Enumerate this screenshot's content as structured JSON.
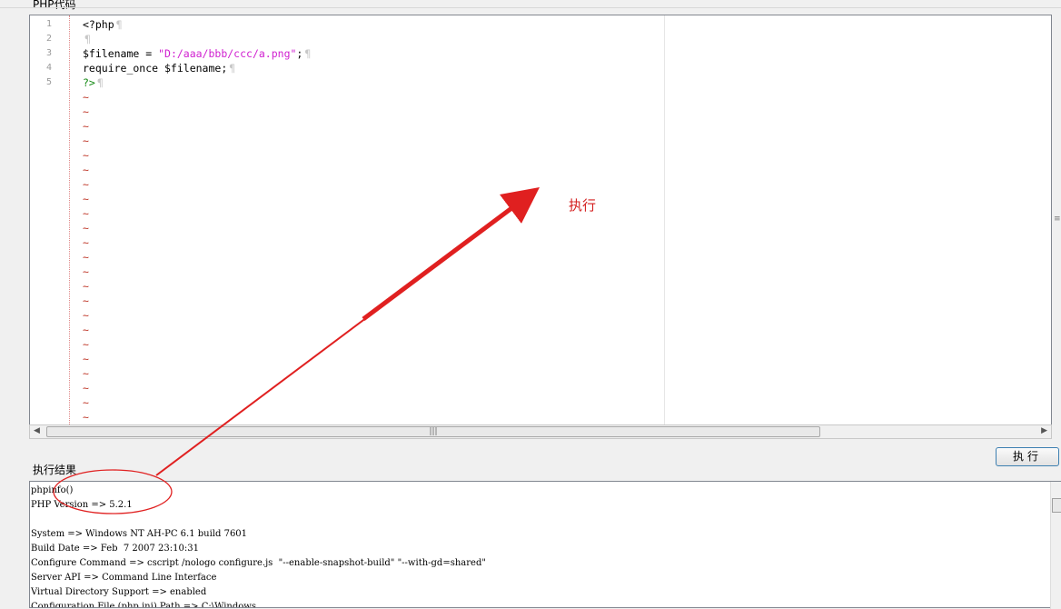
{
  "code_group": {
    "label": "PHP代码"
  },
  "editor": {
    "line_numbers": [
      "1",
      "2",
      "3",
      "4",
      "5"
    ],
    "lines": [
      {
        "a": "<?php",
        "b": "",
        "c": ""
      },
      {
        "a": "",
        "b": "",
        "c": ""
      },
      {
        "a": "$filename = ",
        "b": "\"D:/aaa/bbb/ccc/a.png\"",
        "c": ";"
      },
      {
        "a": "require_once $filename;",
        "b": "",
        "c": ""
      },
      {
        "a": "",
        "b": "",
        "c": "?>"
      }
    ],
    "pilcrow": "¶",
    "empty_marker": "~",
    "empty_line_count": 23
  },
  "annotation": {
    "label": "执行",
    "color": "#e02020"
  },
  "execute_button": {
    "label": "执行"
  },
  "result_group": {
    "label": "执行结果"
  },
  "output": {
    "lines": [
      "phpinfo()",
      "PHP Version => 5.2.1",
      "",
      "System => Windows NT AH-PC 6.1 build 7601",
      "Build Date => Feb  7 2007 23:10:31",
      "Configure Command => cscript /nologo configure.js  \"--enable-snapshot-build\" \"--with-gd=shared\"",
      "Server API => Command Line Interface",
      "Virtual Directory Support => enabled",
      "Configuration File (php.ini) Path => C:\\Windows"
    ]
  }
}
